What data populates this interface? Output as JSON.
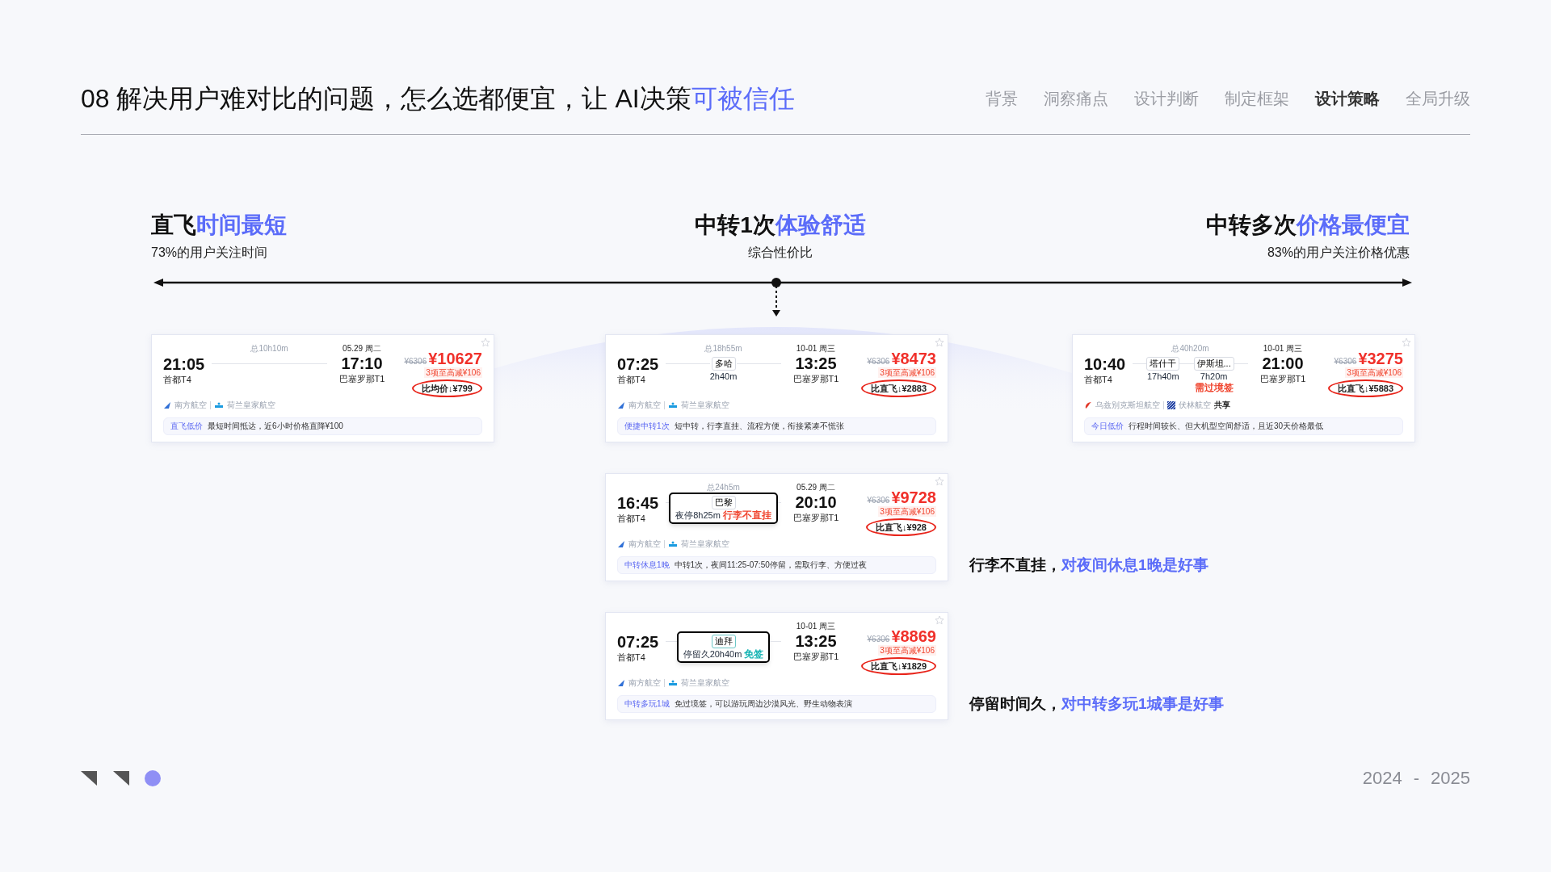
{
  "header": {
    "title": "08 解决用户难对比的问题，怎么选都便宜，让 AI决策",
    "title_highlight": "可被信任",
    "nav": [
      {
        "label": "背景",
        "selected": false
      },
      {
        "label": "洞察痛点",
        "selected": false
      },
      {
        "label": "设计判断",
        "selected": false
      },
      {
        "label": "制定框架",
        "selected": false
      },
      {
        "label": "设计策略",
        "selected": true
      },
      {
        "label": "全局升级",
        "selected": false
      }
    ]
  },
  "categories": [
    {
      "title": "直飞",
      "highlight": "时间最短",
      "subtitle": "73%的用户关注时间"
    },
    {
      "title": "中转1次",
      "highlight": "体验舒适",
      "subtitle": "综合性价比"
    },
    {
      "title": "中转多次",
      "highlight": "价格最便宜",
      "subtitle": "83%的用户关注价格优惠"
    }
  ],
  "columns": [
    {
      "cards": [
        {
          "dep_time": "21:05",
          "dep_airport": "首都T4",
          "duration": "总10h10m",
          "arr_date": "05.29 周二",
          "arr_time": "17:10",
          "arr_airport": "巴塞罗那T1",
          "airlines": [
            {
              "name": "南方航空",
              "kind": "southern"
            },
            {
              "name": "荷兰皇家航空",
              "kind": "klm"
            }
          ],
          "old_price": "¥6306",
          "price": "¥10627",
          "discount": "3项至高减¥106",
          "compare": "比均价↓¥799",
          "tag": "直飞低价",
          "tag_desc": "最短时间抵达，近6小时价格直降¥100"
        }
      ]
    },
    {
      "cards": [
        {
          "dep_time": "07:25",
          "dep_airport": "首都T4",
          "duration": "总18h55m",
          "arr_date": "10-01 周三",
          "arr_time": "13:25",
          "arr_airport": "巴塞罗那T1",
          "stops": [
            {
              "name": "多哈",
              "time": "2h40m",
              "boxed": false,
              "highlight": false
            }
          ],
          "airlines": [
            {
              "name": "南方航空",
              "kind": "southern"
            },
            {
              "name": "荷兰皇家航空",
              "kind": "klm"
            }
          ],
          "old_price": "¥6306",
          "price": "¥8473",
          "discount": "3项至高减¥106",
          "compare": "比直飞↓¥2883",
          "tag": "便捷中转1次",
          "tag_desc": "短中转，行李直挂、流程方便，衔接紧凑不慌张"
        },
        {
          "dep_time": "16:45",
          "dep_airport": "首都T4",
          "duration": "总24h5m",
          "arr_date": "05.29 周二",
          "arr_time": "20:10",
          "arr_airport": "巴塞罗那T1",
          "stops": [
            {
              "name": "巴黎",
              "time": "夜停8h25m",
              "note": "行李不直挂",
              "color": "#f0452f",
              "boxed": true,
              "highlight": false
            }
          ],
          "airlines": [
            {
              "name": "南方航空",
              "kind": "southern"
            },
            {
              "name": "荷兰皇家航空",
              "kind": "klm"
            }
          ],
          "old_price": "¥6306",
          "price": "¥9728",
          "discount": "3项至高减¥106",
          "compare": "比直飞↓¥928",
          "tag": "中转休息1晚",
          "tag_desc": "中转1次，夜间11:25-07:50停留，需取行李、方便过夜",
          "annotation": {
            "text": "行李不直挂，",
            "highlight": "对夜间休息1晚是好事"
          }
        },
        {
          "dep_time": "07:25",
          "dep_airport": "首都T4",
          "arr_date": "10-01 周三",
          "arr_time": "13:25",
          "arr_airport": "巴塞罗那T1",
          "stops": [
            {
              "name": "迪拜",
              "time": "停留久20h40m",
              "note": "免签",
              "color": "#16b3b3",
              "boxed": true,
              "highlight": true
            }
          ],
          "airlines": [
            {
              "name": "南方航空",
              "kind": "southern"
            },
            {
              "name": "荷兰皇家航空",
              "kind": "klm"
            }
          ],
          "old_price": "¥6306",
          "price": "¥8869",
          "discount": "3项至高减¥106",
          "compare": "比直飞↓¥1829",
          "tag": "中转多玩1城",
          "tag_desc": "免过境签，可以游玩周边沙漠风光、野生动物表演",
          "annotation": {
            "text": "停留时间久，",
            "highlight": "对中转多玩1城事是好事"
          }
        }
      ]
    },
    {
      "cards": [
        {
          "dep_time": "10:40",
          "dep_airport": "首都T4",
          "duration": "总40h20m",
          "arr_date": "10-01 周三",
          "arr_time": "21:00",
          "arr_airport": "巴塞罗那T1",
          "stops": [
            {
              "name": "塔什干",
              "time": "17h40m",
              "boxed": false,
              "highlight": false
            },
            {
              "name": "伊斯坦...",
              "time": "7h20m",
              "note": "需过境签",
              "color": "#f0452f",
              "boxed": false,
              "highlight": false
            }
          ],
          "airlines": [
            {
              "name": "乌兹别克斯坦航空",
              "kind": "uzbek"
            },
            {
              "name": "伏林航空",
              "kind": "ural"
            }
          ],
          "codeshare": "共享",
          "old_price": "¥6306",
          "price": "¥3275",
          "discount": "3项至高减¥106",
          "compare": "比直飞↓¥5883",
          "tag": "今日低价",
          "tag_desc": "行程时间较长、但大机型空间舒适，且近30天价格最低"
        }
      ]
    }
  ],
  "footer": {
    "year_start": "2024",
    "separator": "-",
    "year_end": "2025"
  }
}
